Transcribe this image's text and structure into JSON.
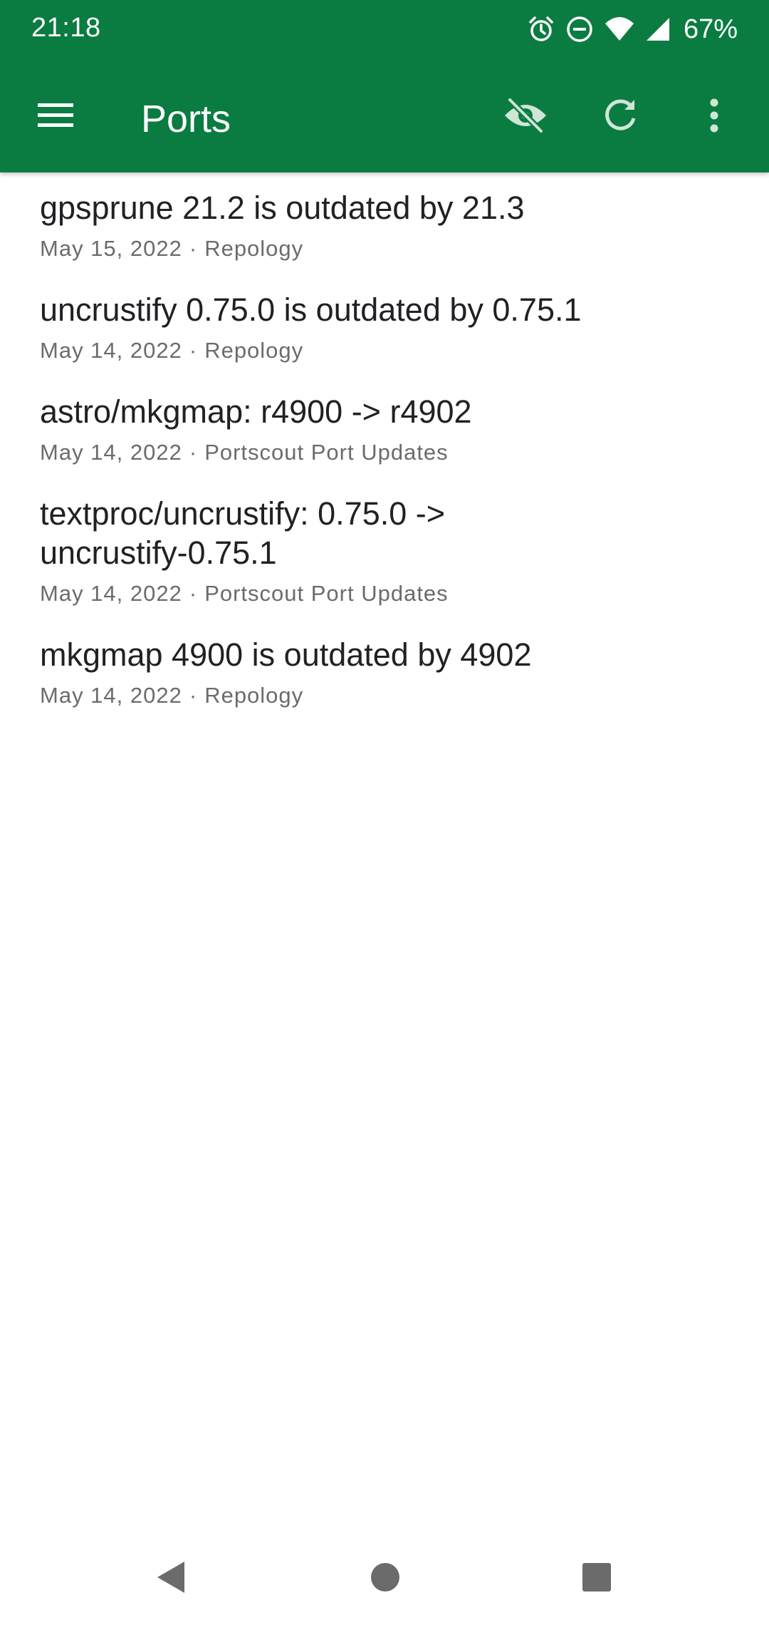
{
  "status_bar": {
    "time": "21:18",
    "battery": "67%",
    "icons": [
      "alarm-icon",
      "do-not-disturb-icon",
      "wifi-icon",
      "cell-signal-icon"
    ]
  },
  "app_bar": {
    "title": "Ports",
    "menu_icon": "hamburger-menu-icon",
    "actions": [
      "visibility-off-icon",
      "refresh-icon",
      "more-vert-icon"
    ],
    "background_color": "#0b7c41"
  },
  "items": [
    {
      "title": "gpsprune 21.2 is outdated by 21.3",
      "date": "May 15, 2022",
      "source": "Repology"
    },
    {
      "title": "uncrustify 0.75.0 is outdated by 0.75.1",
      "date": "May 14, 2022",
      "source": "Repology"
    },
    {
      "title": "astro/mkgmap: r4900 -> r4902",
      "date": "May 14, 2022",
      "source": "Portscout Port Updates"
    },
    {
      "title": "textproc/uncrustify: 0.75.0 -> uncrustify-0.75.1",
      "date": "May 14, 2022",
      "source": "Portscout Port Updates"
    },
    {
      "title": "mkgmap 4900 is outdated by 4902",
      "date": "May 14, 2022",
      "source": "Repology"
    }
  ],
  "separator": "·",
  "nav_bar": {
    "buttons": [
      "back-icon",
      "home-icon",
      "recents-icon"
    ]
  }
}
